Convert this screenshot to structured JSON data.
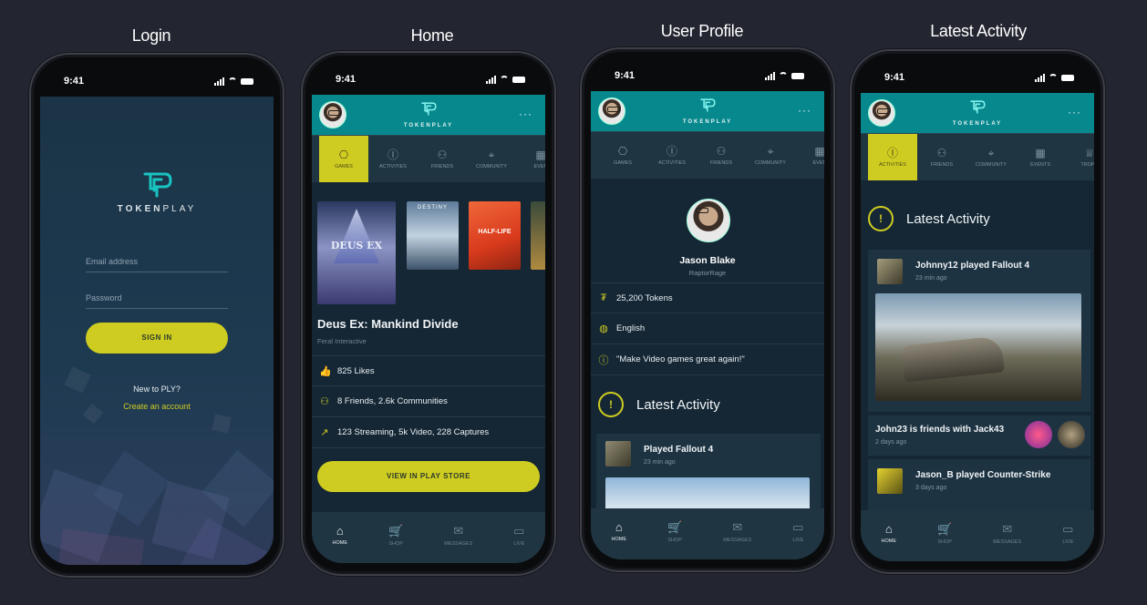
{
  "screens": {
    "login": {
      "title": "Login"
    },
    "home": {
      "title": "Home"
    },
    "profile": {
      "title": "User Profile"
    },
    "activity": {
      "title": "Latest Activity"
    }
  },
  "status": {
    "time": "9:41"
  },
  "brand": {
    "token": "TOKEN",
    "play": "PLAY",
    "full": "TOKENPLAY"
  },
  "login": {
    "email_placeholder": "Email address",
    "password_placeholder": "Password",
    "sign_in": "SIGN IN",
    "new_to": "New to PLY?",
    "create_account": "Create an account"
  },
  "tabs_home": [
    {
      "label": "GAMES",
      "icon": "gamepad-icon",
      "glyph": "⎔"
    },
    {
      "label": "ACTIVITIES",
      "icon": "info-icon",
      "glyph": "ⓘ"
    },
    {
      "label": "FRIENDS",
      "icon": "friends-icon",
      "glyph": "⚇"
    },
    {
      "label": "COMMUNITY",
      "icon": "pin-icon",
      "glyph": "⌖"
    },
    {
      "label": "EVEN",
      "icon": "calendar-icon",
      "glyph": "▦"
    }
  ],
  "tabs_activity": [
    {
      "label": "ACTIVITIES",
      "icon": "info-icon",
      "glyph": "ⓘ"
    },
    {
      "label": "FRIENDS",
      "icon": "friends-icon",
      "glyph": "⚇"
    },
    {
      "label": "COMMUNITY",
      "icon": "pin-icon",
      "glyph": "⌖"
    },
    {
      "label": "EVENTS",
      "icon": "calendar-icon",
      "glyph": "▦"
    },
    {
      "label": "TROPH",
      "icon": "trophy-icon",
      "glyph": "♕"
    }
  ],
  "home": {
    "covers": [
      "DEUS EX",
      "DESTINY",
      "HALF-LIFE",
      ""
    ],
    "game_title": "Deus Ex: Mankind Divide",
    "publisher": "Feral Interactive",
    "likes": "825 Likes",
    "friends": "8 Friends, 2.6k Communities",
    "streaming": "123 Streaming, 5k Video, 228 Captures",
    "store_button": "VIEW IN PLAY STORE"
  },
  "nav": [
    {
      "label": "HOME",
      "glyph": "⌂",
      "icon": "home-icon"
    },
    {
      "label": "SHOP",
      "glyph": "🛒",
      "icon": "cart-icon"
    },
    {
      "label": "MESSAGES",
      "glyph": "✉",
      "icon": "mail-icon"
    },
    {
      "label": "LIVE",
      "glyph": "▭",
      "icon": "video-icon"
    }
  ],
  "profile": {
    "name": "Jason Blake",
    "handle": "RaptorRage",
    "tokens": "25,200 Tokens",
    "language": "English",
    "quote": "\"Make Video games great again!\"",
    "latest_activity": "Latest Activity",
    "feed_title": "Played Fallout 4",
    "feed_time": "23 min ago"
  },
  "activity": {
    "heading": "Latest Activity",
    "items": [
      {
        "title": "Johnny12 played Fallout 4",
        "time": "23 min ago"
      },
      {
        "title": "John23 is friends with Jack43",
        "time": "2 days ago"
      },
      {
        "title": "Jason_B played Counter-Strike",
        "time": "3 days ago"
      }
    ]
  },
  "colors": {
    "accent": "#cfcc21",
    "teal": "#07888d",
    "panel": "#1f3542",
    "bg": "#232631"
  }
}
